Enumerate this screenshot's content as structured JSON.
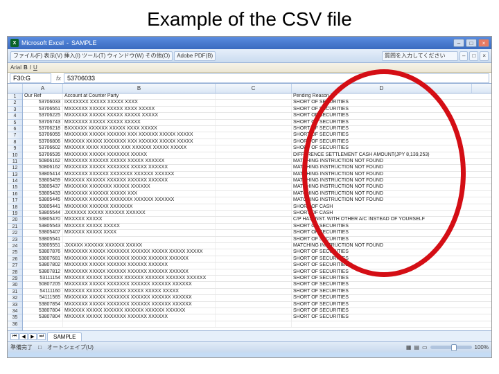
{
  "slide": {
    "title": "Example of the CSV file"
  },
  "window": {
    "app": "Microsoft Excel",
    "doc": "SAMPLE",
    "menu_hint": "ファイル(F)  表示(V)  挿入(I)  ツール(T)  ウィンドウ(W)  その他(O)",
    "pdf_hint": "Adobe PDF(B)",
    "help_placeholder": "質問を入力してください",
    "quick_text": "Arial",
    "namebox": "F30:G",
    "fx_val": "53706033",
    "tab_name": "SAMPLE",
    "status_left": "準備完了　□　オートシェイプ(U)",
    "status_right": "100%"
  },
  "cols": [
    "A",
    "B",
    "C",
    "D"
  ],
  "headers": {
    "A": "Our Ref",
    "B": "Account at Counter Party",
    "C": "",
    "D": "Pending Reason"
  },
  "rows": [
    {
      "a": "53706033",
      "b": "IXXXXXXX XXXXX XXXXX XXXX",
      "d": "SHORT OF SECURITIES"
    },
    {
      "a": "53706551",
      "b": "MXXXXXX XXXXX XXXXX XXXX  XXXXX",
      "d": "SHORT OF SECURITIES"
    },
    {
      "a": "53706225",
      "b": "MXXXXXX XXXXX XXXXX XXXXX  XXXXX",
      "d": "SHORT OF SECURITIES"
    },
    {
      "a": "53706743",
      "b": "MXXXXXX XXXXX XXXXX XXXXX",
      "d": "SHORT OF SECURITIES"
    },
    {
      "a": "53706218",
      "b": "BXXXXXX XXXXXX XXXXX  XXXX XXXXX",
      "d": "SHORT OF SECURITIES"
    },
    {
      "a": "53706055",
      "b": "MXXXXXX XXXXX XXXXXX XXX XXXXXX XXXXX XXXXX",
      "d": "SHORT OF SECURITIES"
    },
    {
      "a": "53706806",
      "b": "MXXXXX XXXXX XXXXXXX XXX XXXXXX XXXXX XXXXX",
      "d": "SHORT OF SECURITIES"
    },
    {
      "a": "53706602",
      "b": "MXXXXX XXXX XXXXXX XXX XXXXXX XXXXX XXXXX",
      "d": "SHORT OF SECURITIES"
    },
    {
      "a": "53706535",
      "b": "MXXXXXX XXXXX XXXXXXX XXXXX",
      "d": "DIFFERENCE  SETTLEMENT CASH AMOUNT(JPY 8,139,253)"
    },
    {
      "a": "50806162",
      "b": "MXXXXXX XXXXXX XXXXX XXXXX XXXXXX",
      "d": "MATCHING INSTRUCTION NOT FOUND"
    },
    {
      "a": "50806162",
      "b": "MXXXXXX XXXXX XXXXXXX XXXXX XXXXXX",
      "d": "MATCHING INSTRUCTION NOT FOUND"
    },
    {
      "a": "53805414",
      "b": "MXXXXXX XXXXXX XXXXXXX XXXXXX XXXXXX",
      "d": "MATCHING INSTRUCTION NOT FOUND"
    },
    {
      "a": "53805459",
      "b": "MXXXXX XXXXXX XXXXXX  XXXXXX XXXXXX",
      "d": "MATCHING INSTRUCTION NOT FOUND"
    },
    {
      "a": "53805437",
      "b": "MXXXXXX XXXXXXX XXXXX XXXXXX",
      "d": "MATCHING INSTRUCTION NOT FOUND"
    },
    {
      "a": "53805433",
      "b": "MXXXXXX XXXXXX XXXXX XXX",
      "d": "MATCHING INSTRUCTION NOT FOUND"
    },
    {
      "a": "53805445",
      "b": "MXXXXXX XXXXXX XXXXXXX XXXXXX XXXXXX",
      "d": "MATCHING INSTRUCTION NOT FOUND"
    },
    {
      "a": "50805441",
      "b": "MXXXXXX XXXXXX XXXXXXX",
      "d": "SHORT OF CASH"
    },
    {
      "a": "53805544",
      "b": "JXXXXXX XXXXX XXXXXX XXXXXX",
      "d": "SHORT OF CASH"
    },
    {
      "a": "53805470",
      "b": "MXXXXX XXXXX",
      "d": "C/P HAS INST. WITH OTHER A/C INSTEAD OF YOURSELF"
    },
    {
      "a": "53805543",
      "b": "MXXXXX XXXXX XXXXX",
      "d": "SHORT OF SECURITIES"
    },
    {
      "a": "53805407",
      "b": "MXXXXX XXXXX XXXX",
      "d": "SHORT OF SECURITIES"
    },
    {
      "a": "53805541",
      "b": "",
      "d": "SHORT OF SECURITIES"
    },
    {
      "a": "53805551",
      "b": "JXXXXX XXXXXX XXXXXX  XXXXX",
      "d": "MATCHING INSTRUCTION NOT FOUND"
    },
    {
      "a": "53807876",
      "b": "MXXXXXX XXXXX XXXXXXX XXXXXX XXXXX XXXXX XXXXX",
      "d": "SHORT OF SECURITIES"
    },
    {
      "a": "53807681",
      "b": "MXXXXXX XXXXX XXXXXXX XXXXX XXXXXX XXXXXX",
      "d": "SHORT OF SECURITIES"
    },
    {
      "a": "53807802",
      "b": "MXXXXXX XXXXX XXXXXX XXXXXX XXXXXX",
      "d": "SHORT OF SECURITIES"
    },
    {
      "a": "53807812",
      "b": "MXXXXXX XXXXX XXXXXX XXXXXX XXXXXX XXXXXX",
      "d": "SHORT OF SECURITIES"
    },
    {
      "a": "53111154",
      "b": "MXXXXX XXXXX XXXXXX XXXXXX XXXXXX XXXXXX XXXXXX",
      "d": "SHORT OF SECURITIES"
    },
    {
      "a": "50807205",
      "b": "MXXXXXX XXXXX XXXXXXX XXXXXX XXXXXX XXXXXX",
      "d": "SHORT OF SECURITIES"
    },
    {
      "a": "54111160",
      "b": "MXXXXX XXXXX XXXXXXX XXXXX XXXXX XXXXX",
      "d": "SHORT OF SECURITIES"
    },
    {
      "a": "54111565",
      "b": "MXXXXXX XXXXX XXXXXXX XXXXXX XXXXXX XXXXXX",
      "d": "SHORT OF SECURITIES"
    },
    {
      "a": "53807854",
      "b": "MXXXXXX XXXXX XXXXXXX XXXXXX XXXXXX XXXXXX",
      "d": "SHORT OF SECURITIES"
    },
    {
      "a": "53807804",
      "b": "MXXXXX XXXXX XXXXXX XXXXXX XXXXXX XXXXXX",
      "d": "SHORT OF SECURITIES"
    },
    {
      "a": "53807804",
      "b": "MXXXXX XXXXX XXXXXXX XXXXXX XXXXXX",
      "d": "SHORT OF SECURITIES"
    }
  ]
}
